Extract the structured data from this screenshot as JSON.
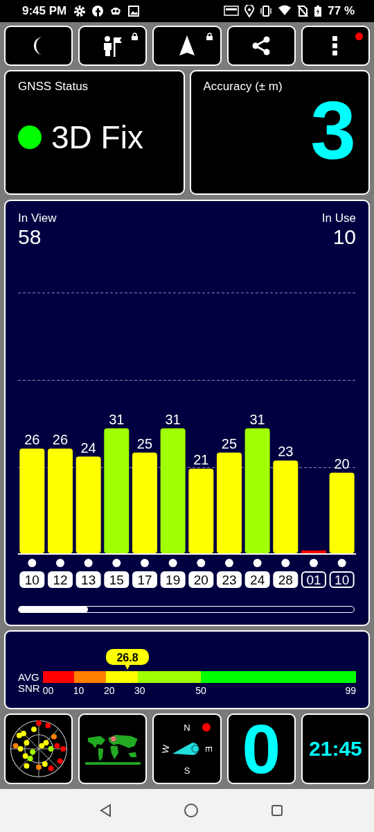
{
  "status_bar": {
    "time": "9:45 PM",
    "battery": "77 %"
  },
  "toolbar": [
    {
      "kind": "night",
      "locked": false,
      "notification": false
    },
    {
      "kind": "waypoint",
      "locked": true,
      "notification": false
    },
    {
      "kind": "navigate",
      "locked": true,
      "notification": false
    },
    {
      "kind": "share",
      "locked": false,
      "notification": false
    },
    {
      "kind": "menu",
      "locked": false,
      "notification": true
    }
  ],
  "gnss_status": {
    "title": "GNSS Status",
    "fix": "3D Fix",
    "color": "#00ff00"
  },
  "accuracy": {
    "title": "Accuracy (± m)",
    "value": "3"
  },
  "satellites_panel": {
    "in_view_label": "In View",
    "in_view": "58",
    "in_use_label": "In Use",
    "in_use": "10",
    "chart_data": {
      "type": "bar",
      "categories": [
        "10",
        "12",
        "13",
        "15",
        "17",
        "19",
        "20",
        "23",
        "24",
        "28",
        "01",
        "10"
      ],
      "values": [
        26,
        26,
        24,
        31,
        25,
        31,
        21,
        25,
        31,
        23,
        null,
        20
      ],
      "data_labels": true
    },
    "satellites": [
      {
        "used": true
      },
      {
        "used": true
      },
      {
        "used": true
      },
      {
        "used": true
      },
      {
        "used": true
      },
      {
        "used": true
      },
      {
        "used": true
      },
      {
        "used": true
      },
      {
        "used": true
      },
      {
        "used": true
      },
      {
        "used": false
      },
      {
        "used": false
      }
    ]
  },
  "snr": {
    "label_1": "AVG",
    "label_2": "SNR",
    "average": "26.8",
    "segments": [
      {
        "label": "00",
        "color": "#ff0000"
      },
      {
        "label": "10",
        "color": "#ff8000"
      },
      {
        "label": "20",
        "color": "#ffff00"
      },
      {
        "label": "30",
        "color": "#a0ff00"
      },
      {
        "label": "50",
        "color": "#00ff00"
      }
    ],
    "end_label": "99"
  },
  "tiles": [
    {
      "kind": "skyplot"
    },
    {
      "kind": "worldmap"
    },
    {
      "kind": "compass",
      "north": "N",
      "east": "E",
      "south": "S",
      "west": "W",
      "notification": true
    },
    {
      "kind": "number",
      "value": "0"
    },
    {
      "kind": "clock",
      "value": "21:45"
    }
  ]
}
